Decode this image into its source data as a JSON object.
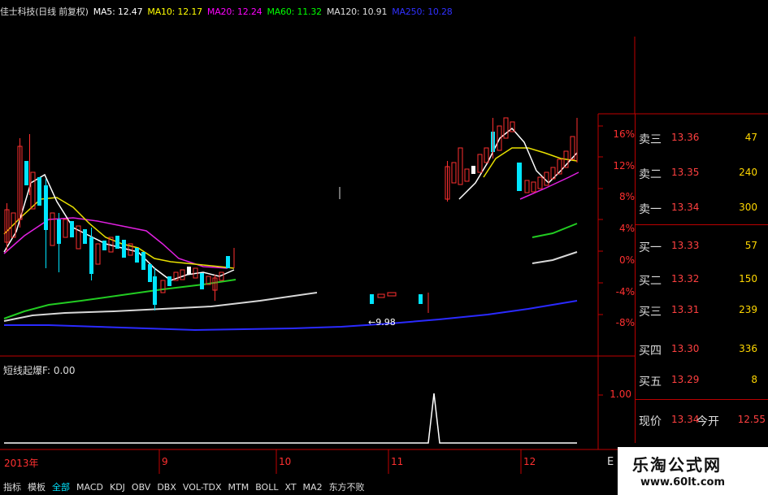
{
  "header": {
    "title": "佳士科技(日线 前复权)",
    "ma5": "MA5: 12.47",
    "ma10": "MA10: 12.17",
    "ma20": "MA20: 12.24",
    "ma60": "MA60: 11.32",
    "ma120": "MA120: 10.91",
    "ma250": "MA250: 10.28",
    "colors": {
      "ma5": "#ffffff",
      "ma10": "#ffff00",
      "ma20": "#ff00ff",
      "ma60": "#00ff00",
      "ma120": "#dddddd",
      "ma250": "#3030ff"
    }
  },
  "price_axis": [
    "16%",
    "12%",
    "8%",
    "4%",
    "0%",
    "-4%",
    "-8%"
  ],
  "min_price_label": "←9.98",
  "indicator": {
    "label": "短线起爆F: 0.00",
    "axis_label": "1.00"
  },
  "time_axis": [
    "2013年",
    "9",
    "10",
    "11",
    "12"
  ],
  "orderbook": {
    "sell": [
      {
        "label": "卖三",
        "price": "13.36",
        "volume": "47"
      },
      {
        "label": "卖二",
        "price": "13.35",
        "volume": "240"
      },
      {
        "label": "卖一",
        "price": "13.34",
        "volume": "300"
      }
    ],
    "buy": [
      {
        "label": "买一",
        "price": "13.33",
        "volume": "57"
      },
      {
        "label": "买二",
        "price": "13.32",
        "volume": "150"
      },
      {
        "label": "买三",
        "price": "13.31",
        "volume": "239"
      },
      {
        "label": "买四",
        "price": "13.30",
        "volume": "336"
      },
      {
        "label": "买五",
        "price": "13.29",
        "volume": "8"
      }
    ],
    "current_label": "现价",
    "current_price": "13.34",
    "open_label": "今开",
    "open_price": "12.55"
  },
  "tabs": [
    "指标",
    "模板",
    "全部",
    "MACD",
    "KDJ",
    "OBV",
    "DBX",
    "VOL-TDX",
    "MTM",
    "BOLL",
    "XT",
    "MA2",
    "东方不败"
  ],
  "active_tab": "全部",
  "right_edge_letter": "E",
  "watermark": {
    "line1": "乐淘公式网",
    "line2": "www.60lt.com"
  }
}
